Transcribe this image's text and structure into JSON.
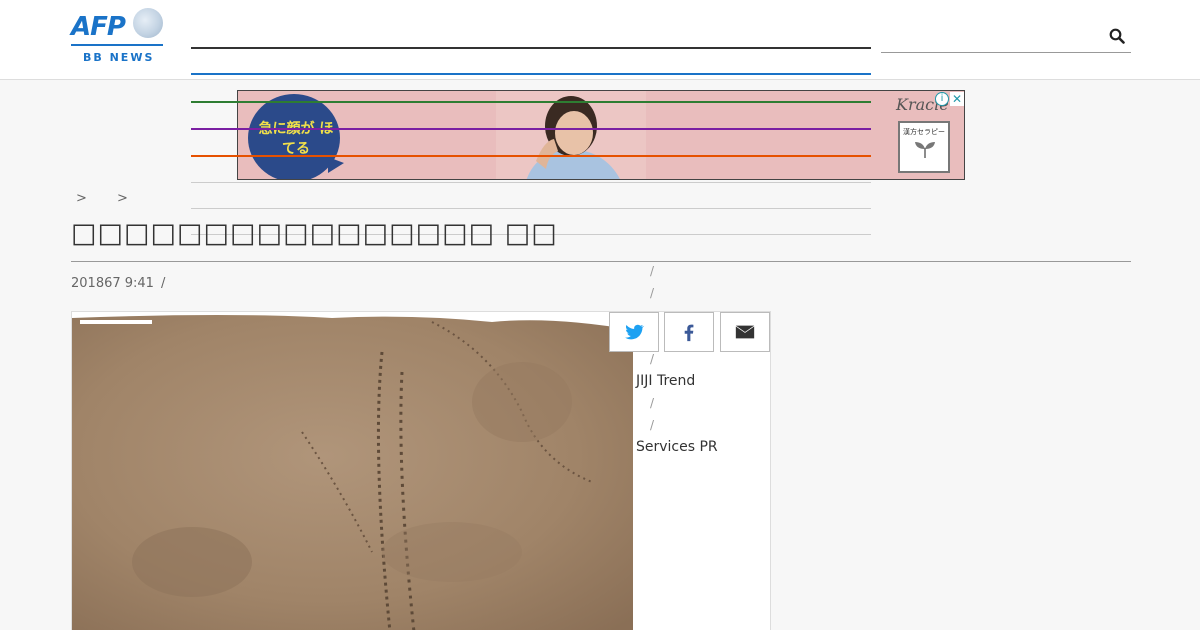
{
  "header": {
    "logo_main": "AFP",
    "logo_sub": "BB NEWS",
    "search_placeholder": ""
  },
  "ad": {
    "headline": "急に顔が ほてる",
    "brand": "Kracie",
    "info": "i",
    "close": "✕",
    "box_label": "漢方セラピー"
  },
  "breadcrumbs": [
    ">",
    ">"
  ],
  "article": {
    "title": "□□□□□□□□□□□□□□□□ □□",
    "date": "201867 9:41",
    "date_separator": "/"
  },
  "sidebar": {
    "slash": "/",
    "links": [
      "JIJI Trend",
      "Services PR"
    ]
  },
  "colors": {
    "brand": "#1a73c8",
    "rule_blue": "#1a73c8",
    "rule_green": "#2e7d32",
    "rule_purple": "#7b1fa2",
    "rule_orange": "#e65100"
  },
  "icons": {
    "search": "search-icon",
    "twitter": "twitter-icon",
    "facebook": "facebook-icon",
    "mail": "mail-icon"
  }
}
